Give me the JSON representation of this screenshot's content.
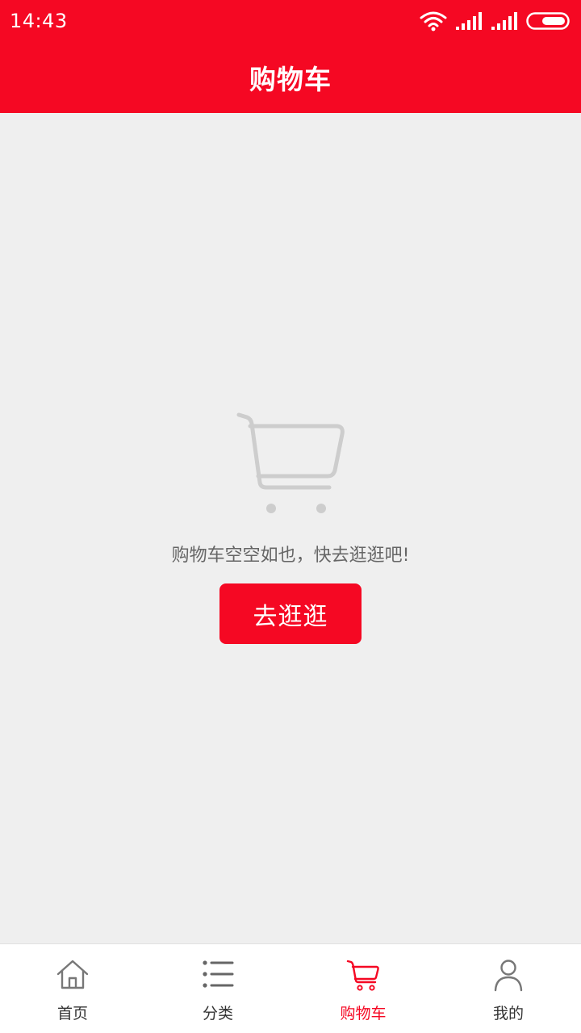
{
  "status_bar": {
    "time": "14:43",
    "icons": [
      "wifi-icon",
      "signal-icon",
      "signal-icon",
      "battery-icon"
    ]
  },
  "header": {
    "title": "购物车"
  },
  "empty_state": {
    "icon": "shopping-cart-icon",
    "message": "购物车空空如也，快去逛逛吧!",
    "button_label": "去逛逛"
  },
  "tabbar": {
    "active_index": 2,
    "items": [
      {
        "label": "首页",
        "icon": "home-icon"
      },
      {
        "label": "分类",
        "icon": "list-icon"
      },
      {
        "label": "购物车",
        "icon": "cart-icon"
      },
      {
        "label": "我的",
        "icon": "user-icon"
      }
    ]
  },
  "colors": {
    "brand": "#f50823",
    "background": "#efefef",
    "muted_icon": "#cccccc",
    "tab_text": "#333333"
  }
}
